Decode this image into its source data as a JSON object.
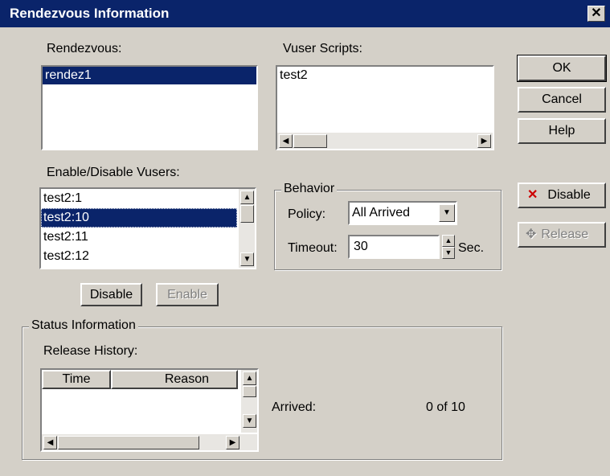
{
  "dialog": {
    "title": "Rendezvous Information",
    "close_glyph": "✕"
  },
  "rendezvous": {
    "label": "Rendezvous:",
    "items": [
      "rendez1"
    ]
  },
  "vuser_scripts": {
    "label": "Vuser Scripts:",
    "items": [
      "test2"
    ]
  },
  "vusers": {
    "label": "Enable/Disable Vusers:",
    "items": [
      "test2:1",
      "test2:10",
      "test2:11",
      "test2:12"
    ],
    "disable_label": "Disable",
    "enable_label": "Enable"
  },
  "behavior": {
    "title": "Behavior",
    "policy_label": "Policy:",
    "policy_value": "All Arrived",
    "timeout_label": "Timeout:",
    "timeout_value": "30",
    "timeout_unit": "Sec."
  },
  "buttons": {
    "ok": "OK",
    "cancel": "Cancel",
    "help": "Help",
    "disable": "Disable",
    "release": "Release"
  },
  "status": {
    "title": "Status Information",
    "release_history_label": "Release History:",
    "columns": [
      "Time",
      "Reason"
    ],
    "arrived_label": "Arrived:",
    "arrived_value": "0 of 10"
  },
  "colors": {
    "selection": "#0a246a",
    "face": "#d4d0c8",
    "disable_x": "#cc0000"
  }
}
